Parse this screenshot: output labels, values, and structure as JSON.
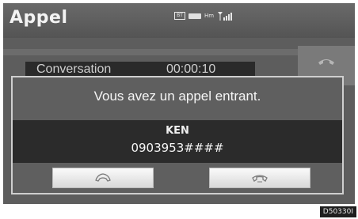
{
  "header": {
    "title": "Appel",
    "status": {
      "bt_label": "BT",
      "hm_label": "Hm"
    }
  },
  "background_call": {
    "label": "Conversation",
    "duration": "00:00:10"
  },
  "popup": {
    "message": "Vous avez un appel entrant.",
    "caller_name": "KEN",
    "caller_number": "0903953####",
    "answer_icon": "phone-answer-icon",
    "decline_icon": "phone-hangup-icon"
  },
  "figure_code": "D50330I"
}
